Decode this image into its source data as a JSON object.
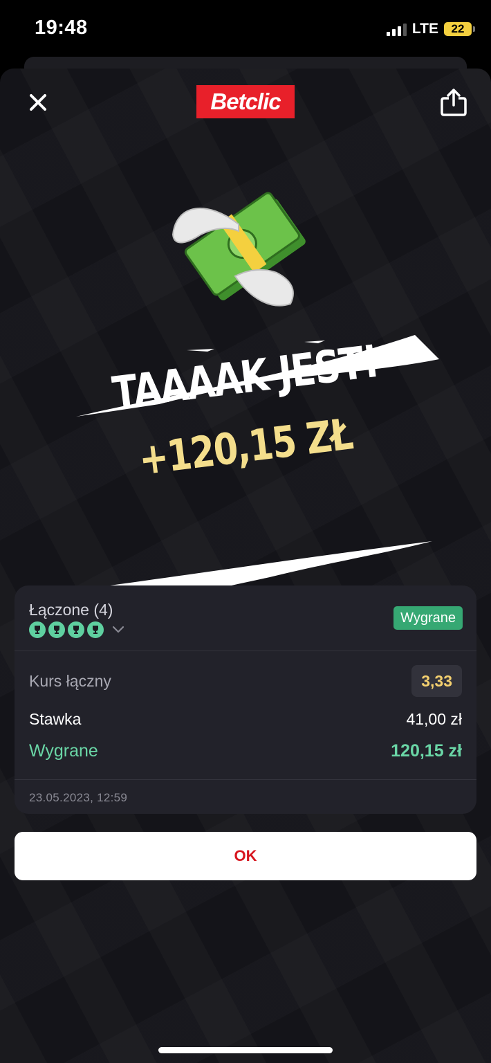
{
  "status_bar": {
    "time": "19:48",
    "network": "LTE",
    "battery": "22"
  },
  "header": {
    "logo": "Betclic",
    "close_icon": "close-icon",
    "share_icon": "share-icon"
  },
  "celebration": {
    "headline": "TAAAAK JEST!",
    "amount": "+120,15 ZŁ",
    "illustration": "flying-money-icon"
  },
  "bet": {
    "type_label": "Łączone (4)",
    "selections_won": 4,
    "status": "Wygrane",
    "odds_label": "Kurs łączny",
    "odds_value": "3,33",
    "stake_label": "Stawka",
    "stake_value": "41,00 zł",
    "winnings_label": "Wygrane",
    "winnings_value": "120,15 zł",
    "date": "23.05.2023, 12:59"
  },
  "actions": {
    "ok_label": "OK"
  },
  "colors": {
    "brand": "#e8202a",
    "win_green": "#6ad6a6",
    "badge_green": "#36a873",
    "odds_yellow": "#f4d06f",
    "amount_gold": "#f4de8c"
  }
}
